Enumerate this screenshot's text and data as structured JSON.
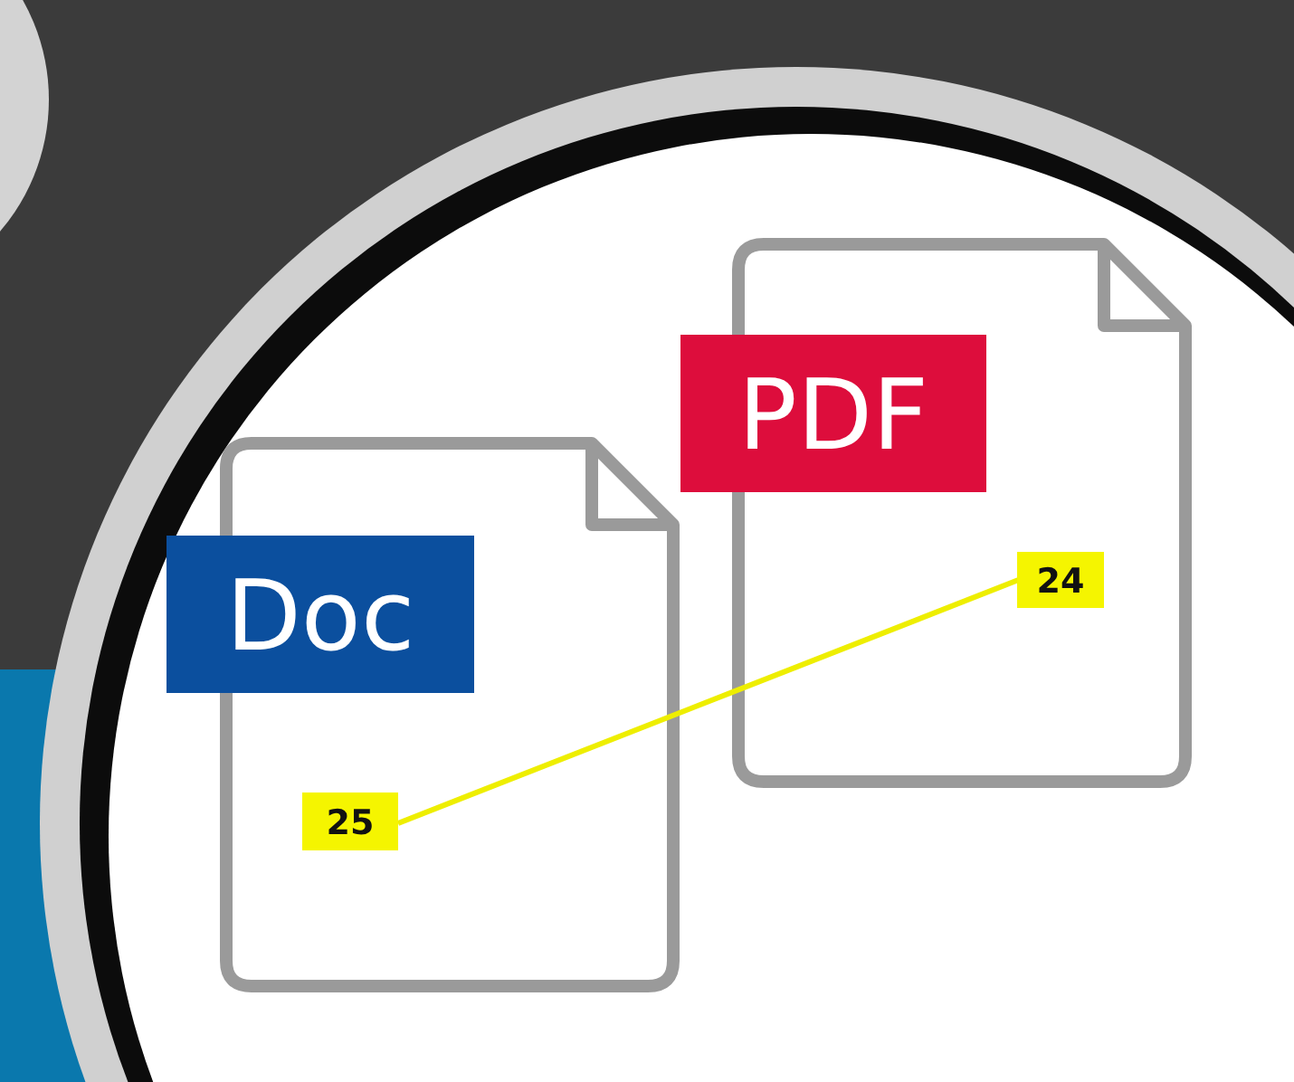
{
  "documents": [
    {
      "label": "Doc",
      "color": "#0b4f9e"
    },
    {
      "label": "PDF",
      "color": "#dd0d3c"
    }
  ],
  "markers": [
    "25",
    "24"
  ]
}
